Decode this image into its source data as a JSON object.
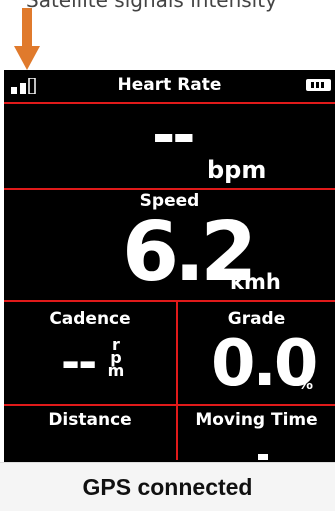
{
  "caption": "Satellite signals intensity",
  "status_bar": {
    "title": "Heart Rate",
    "signal_bars_lit": 2,
    "signal_bars_total": 3,
    "battery_icon": "battery-icon"
  },
  "heart_rate": {
    "value": "--",
    "unit": "bpm"
  },
  "speed": {
    "label": "Speed",
    "value": "6.2",
    "unit": "kmh"
  },
  "cadence": {
    "label": "Cadence",
    "value": "--",
    "unit_letters": [
      "r",
      "p",
      "m"
    ]
  },
  "grade": {
    "label": "Grade",
    "value": "0.0",
    "unit": "%"
  },
  "distance": {
    "label": "Distance"
  },
  "moving_time": {
    "label": "Moving Time"
  },
  "toast": "GPS connected",
  "colors": {
    "accent_arrow": "#e07a2c",
    "divider": "#e01a1a",
    "screen_bg": "#000000"
  }
}
